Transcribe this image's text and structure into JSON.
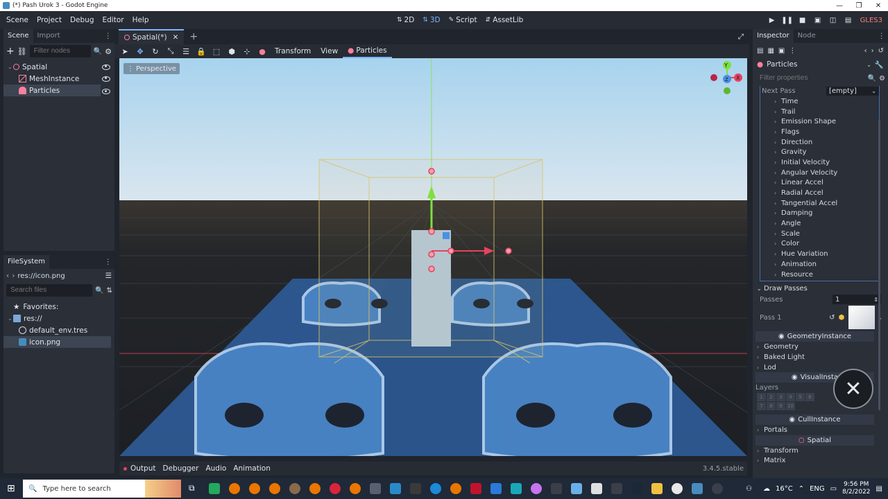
{
  "window": {
    "title": "(*) Pash Urok 3 - Godot Engine",
    "buttons": [
      "—",
      "❐",
      "✕"
    ]
  },
  "menu": [
    "Scene",
    "Project",
    "Debug",
    "Editor",
    "Help"
  ],
  "workspaces": [
    {
      "label": "2D",
      "active": false
    },
    {
      "label": "3D",
      "active": true
    },
    {
      "label": "Script",
      "active": false
    },
    {
      "label": "AssetLib",
      "active": false
    }
  ],
  "renderer": "GLES3",
  "scene_dock": {
    "tabs": [
      "Scene",
      "Import"
    ],
    "filter_placeholder": "Filter nodes",
    "nodes": [
      {
        "label": "Spatial",
        "indent": 0
      },
      {
        "label": "MeshInstance",
        "indent": 1
      },
      {
        "label": "Particles",
        "indent": 1
      }
    ]
  },
  "filesystem": {
    "title": "FileSystem",
    "path": "res://icon.png",
    "search_placeholder": "Search files",
    "items": [
      {
        "label": "Favorites:"
      },
      {
        "label": "res://"
      },
      {
        "label": "default_env.tres"
      },
      {
        "label": "icon.png"
      }
    ]
  },
  "editor_tab": {
    "label": "Spatial(*)",
    "add": "+"
  },
  "viewport_toolbar": {
    "transform": "Transform",
    "view": "View",
    "particles": "Particles"
  },
  "viewport": {
    "label": "Perspective",
    "gizmo_y": "Y",
    "gizmo_x": "X",
    "gizmo_z": "Z"
  },
  "bottom_panel": {
    "tabs": [
      "Output",
      "Debugger",
      "Audio",
      "Animation"
    ],
    "version": "3.4.5.stable"
  },
  "inspector": {
    "tabs": [
      "Inspector",
      "Node"
    ],
    "object": "Particles",
    "filter_placeholder": "Filter properties",
    "next_pass_label": "Next Pass",
    "next_pass_value": "[empty]",
    "groups": [
      "Time",
      "Trail",
      "Emission Shape",
      "Flags",
      "Direction",
      "Gravity",
      "Initial Velocity",
      "Angular Velocity",
      "Linear Accel",
      "Radial Accel",
      "Tangential Accel",
      "Damping",
      "Angle",
      "Scale",
      "Color",
      "Hue Variation",
      "Animation",
      "Resource"
    ],
    "draw_passes": "Draw Passes",
    "passes_label": "Passes",
    "passes_value": "1",
    "pass1_label": "Pass 1",
    "geometry_instance": "GeometryInstance",
    "geometry_groups": [
      "Geometry",
      "Baked Light",
      "Lod"
    ],
    "visual_instance": "VisualInsta",
    "layers_label": "Layers",
    "layer_numbers": [
      "1",
      "2",
      "3",
      "4",
      "5",
      "6",
      "7",
      "8",
      "9",
      "10"
    ],
    "cull_instance": "CullInstance",
    "cull_groups": [
      "Portals"
    ],
    "spatial": "Spatial",
    "spatial_groups": [
      "Transform",
      "Matrix"
    ]
  },
  "taskbar": {
    "search_placeholder": "Type here to search",
    "weather": "16°C",
    "language": "ENG",
    "time": "9:56 PM",
    "date": "8/2/2022"
  },
  "colors": {
    "accent": "#7eb6ff",
    "sky_top": "#a9d4ee",
    "ground": "#23272e",
    "tile_blue": "#3b6fb0",
    "gizmo_green": "#7ee03c",
    "gizmo_red": "#e8425e"
  }
}
